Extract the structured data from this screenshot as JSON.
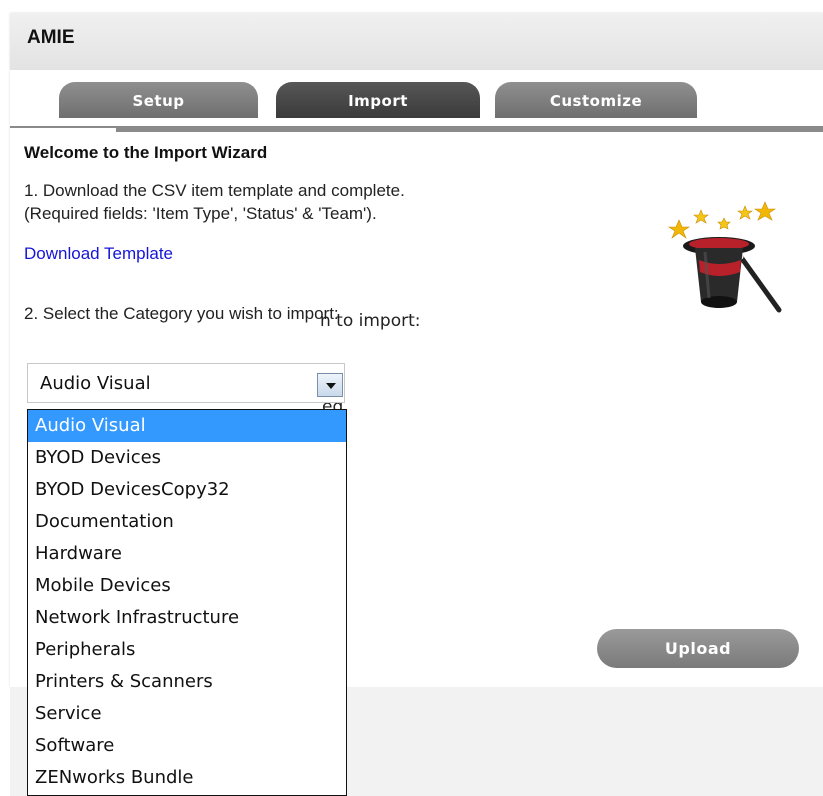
{
  "app": {
    "title": "AMIE"
  },
  "tabs": [
    {
      "label": "Setup"
    },
    {
      "label": "Import"
    },
    {
      "label": "Customize"
    }
  ],
  "wizard": {
    "heading": "Welcome to the Import Wizard",
    "step1_line1": "1. Download the CSV item template and complete.",
    "step1_line2": "(Required fields: 'Item Type', 'Status' & 'Team').",
    "download_link": "Download Template",
    "step2": "2. Select the Category you wish to import:",
    "hidden_text_partial_1": "n to import:",
    "hidden_text_partial_2": "ed."
  },
  "category_select": {
    "selected": "Audio Visual",
    "options": [
      "Audio Visual",
      "BYOD Devices",
      "BYOD DevicesCopy32",
      "Documentation",
      "Hardware",
      "Mobile Devices",
      "Network Infrastructure",
      "Peripherals",
      "Printers & Scanners",
      "Service",
      "Software",
      "ZENworks Bundle"
    ]
  },
  "buttons": {
    "upload": "Upload"
  },
  "icons": {
    "wizard": "magic-hat-icon"
  },
  "colors": {
    "link": "#1515d8",
    "selection": "#3399ff",
    "active_tab": "#3a3a3a",
    "inactive_tab": "#7f7f7f"
  }
}
